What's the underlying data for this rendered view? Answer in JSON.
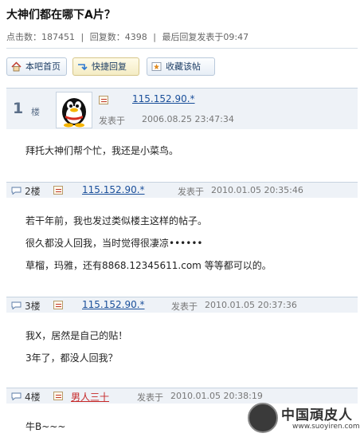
{
  "thread": {
    "title": "大神们都在哪下A片？",
    "stats": {
      "clicks": "点击数：187451",
      "sep1": "|",
      "replies": "回复数：4398",
      "sep2": "|",
      "last_reply": "最后回复发表于09:47"
    }
  },
  "toolbar": {
    "home": "本吧首页",
    "quick_reply": "快捷回复",
    "favorite": "收藏该帖"
  },
  "posts": [
    {
      "floor_num": "1",
      "floor_suffix": "楼",
      "ip": "115.152.90.*",
      "posted_label": "发表于",
      "time": "2006.08.25 23:47:34",
      "lines": [
        "拜托大神们帮个忙，我还是小菜鸟。"
      ]
    },
    {
      "floor": "2楼",
      "ip": "115.152.90.*",
      "posted_label": "发表于",
      "time": "2010.01.05 20:35:46",
      "lines": [
        "若干年前，我也发过类似楼主这样的帖子。",
        "很久都没人回我，当时觉得很凄凉••••••",
        "草榴，玛雅，还有8868.12345611.com 等等都可以的。"
      ]
    },
    {
      "floor": "3楼",
      "ip": "115.152.90.*",
      "posted_label": "发表于",
      "time": "2010.01.05 20:37:36",
      "lines": [
        "我X，居然是自己的贴！",
        "3年了，都没人回我？"
      ]
    },
    {
      "floor": "4楼",
      "user": "男人三十",
      "posted_label": "发表于",
      "time": "2010.01.05 20:38:19",
      "lines": [
        "牛B~~~"
      ]
    }
  ],
  "watermark": {
    "text": "中国頑皮人",
    "url": "www.suoyiren.com"
  },
  "colors": {
    "link_blue": "#1a4f9a",
    "user_red": "#c62828",
    "floor_bar_bg": "#eef2f7"
  }
}
